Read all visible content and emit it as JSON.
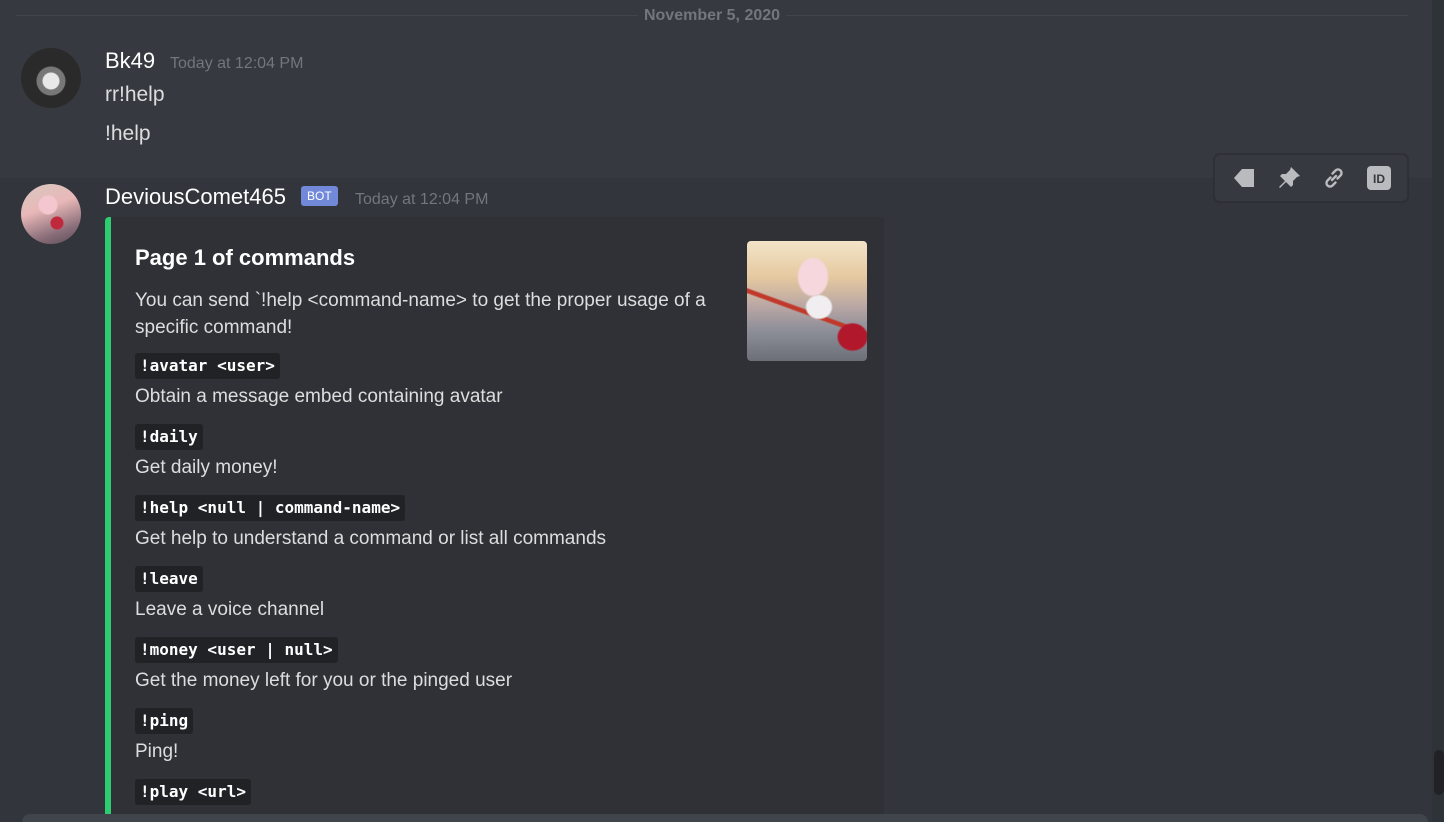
{
  "divider": {
    "date": "November 5, 2020"
  },
  "messages": [
    {
      "author": "Bk49",
      "timestamp": "Today at 12:04 PM",
      "lines": [
        "rr!help",
        "!help"
      ]
    },
    {
      "author": "DeviousComet465",
      "bot_tag": "BOT",
      "timestamp": "Today at 12:04 PM"
    }
  ],
  "toolbar": {
    "icons": [
      "tag-icon",
      "pin-icon",
      "link-icon",
      "id-icon"
    ],
    "id_label": "ID"
  },
  "embed": {
    "accent_color": "#2ecc71",
    "title": "Page 1 of commands",
    "description": "You can send `!help <command-name> to get the proper usage of a specific command!",
    "fields": [
      {
        "name": "!avatar <user>",
        "value": "Obtain a message embed containing avatar"
      },
      {
        "name": "!daily",
        "value": "Get daily money!"
      },
      {
        "name": "!help <null | command-name>",
        "value": "Get help to understand a command or list all commands"
      },
      {
        "name": "!leave",
        "value": "Leave a voice channel"
      },
      {
        "name": "!money <user | null>",
        "value": "Get the money left for you or the pinged user"
      },
      {
        "name": "!ping",
        "value": "Ping!"
      },
      {
        "name": "!play <url>",
        "value": ""
      }
    ]
  },
  "colors": {
    "background": "#36393f",
    "embed_bg": "#2f3136",
    "bot_tag": "#7289da",
    "code_bg": "#202225"
  }
}
